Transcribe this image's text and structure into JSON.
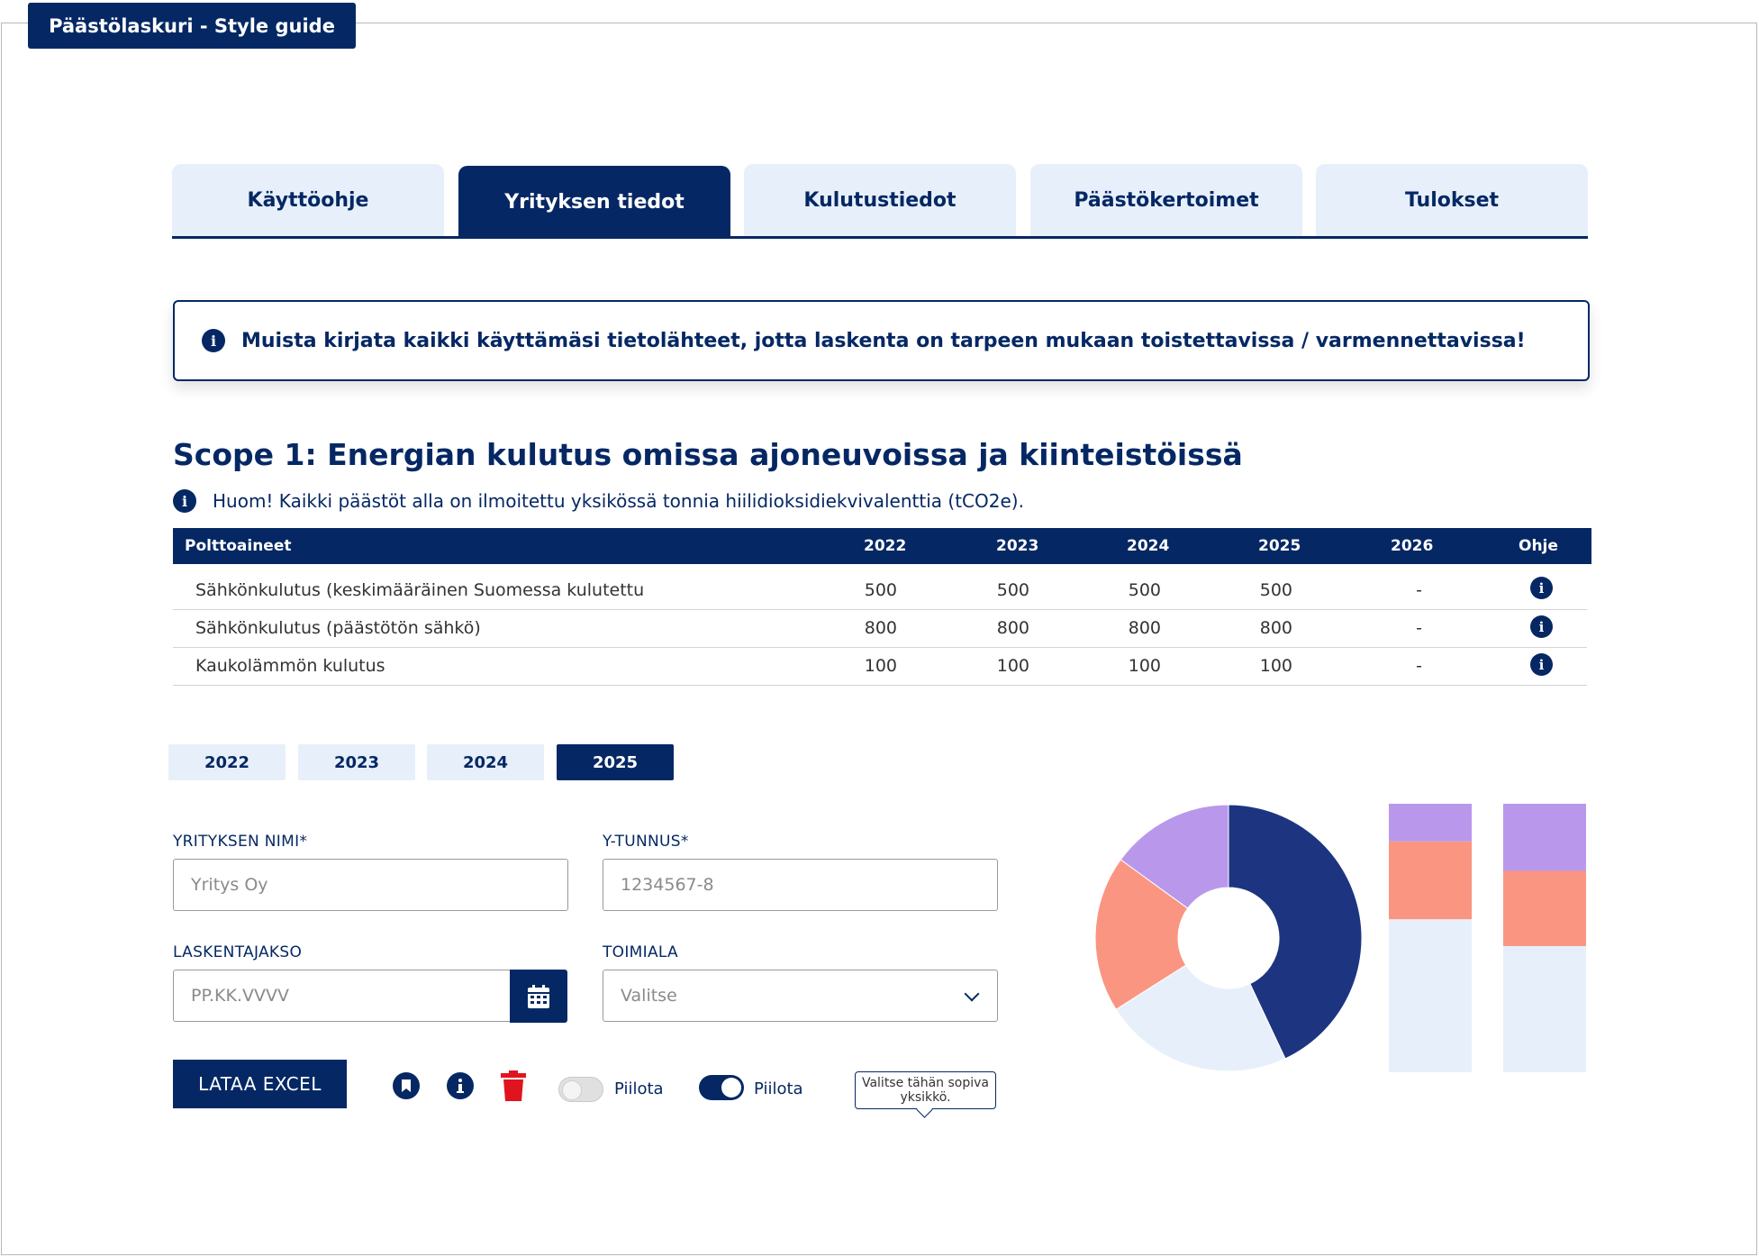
{
  "app": {
    "title": "Päästölaskuri - Style guide"
  },
  "tabs": [
    {
      "label": "Käyttöohje",
      "active": false
    },
    {
      "label": "Yrityksen tiedot",
      "active": true
    },
    {
      "label": "Kulutustiedot",
      "active": false
    },
    {
      "label": "Päästökertoimet",
      "active": false
    },
    {
      "label": "Tulokset",
      "active": false
    }
  ],
  "notice": {
    "icon": "info-icon",
    "text": "Muista kirjata kaikki käyttämäsi tietolähteet, jotta laskenta on tarpeen mukaan toistettavissa / varmennettavissa!"
  },
  "scope": {
    "title": "Scope 1: Energian kulutus omissa ajoneuvoissa ja kiinteistöissä",
    "note": "Huom! Kaikki päästöt alla on ilmoitettu yksikössä tonnia hiilidioksidiekvivalenttia (tCO2e)."
  },
  "table": {
    "headers": [
      "Polttoaineet",
      "2022",
      "2023",
      "2024",
      "2025",
      "2026",
      "Ohje"
    ],
    "rows": [
      {
        "name": "Sähkönkulutus (keskimääräinen Suomessa kulutettu",
        "values": [
          "500",
          "500",
          "500",
          "500",
          "-"
        ]
      },
      {
        "name": "Sähkönkulutus (päästötön sähkö)",
        "values": [
          "800",
          "800",
          "800",
          "800",
          "-"
        ]
      },
      {
        "name": "Kaukolämmön kulutus",
        "values": [
          "100",
          "100",
          "100",
          "100",
          "-"
        ]
      }
    ]
  },
  "years": [
    {
      "label": "2022",
      "active": false
    },
    {
      "label": "2023",
      "active": false
    },
    {
      "label": "2024",
      "active": false
    },
    {
      "label": "2025",
      "active": true
    }
  ],
  "form": {
    "company_name": {
      "label": "YRITYKSEN NIMI*",
      "placeholder": "Yritys Oy"
    },
    "business_id": {
      "label": "Y-TUNNUS*",
      "placeholder": "1234567-8"
    },
    "period": {
      "label": "LASKENTAJAKSO",
      "placeholder": "PP.KK.VVVV"
    },
    "industry": {
      "label": "TOIMIALA",
      "selected": "Valitse"
    }
  },
  "actions": {
    "excel_label": "LATAA EXCEL",
    "toggle_off_label": "Piilota",
    "toggle_on_label": "Piilota",
    "tooltip": "Valitse tähän sopiva yksikkö."
  },
  "colors": {
    "navy": "#052864",
    "light": "#e7f0fa",
    "purple": "#b998ec",
    "salmon": "#fa9582",
    "donut_dark": "#1d3580",
    "danger": "#e0141e"
  },
  "chart_data": [
    {
      "type": "pie",
      "variant": "donut",
      "slices": [
        {
          "value": 43,
          "color": "#1d3580"
        },
        {
          "value": 23,
          "color": "#e7f0fa"
        },
        {
          "value": 19,
          "color": "#fa9582"
        },
        {
          "value": 15,
          "color": "#b998ec"
        }
      ]
    },
    {
      "type": "bar",
      "stacked": true,
      "series": [
        {
          "color": "#e7f0fa",
          "values": [
            57,
            47
          ]
        },
        {
          "color": "#fa9582",
          "values": [
            29,
            28
          ]
        },
        {
          "color": "#b998ec",
          "values": [
            14,
            25
          ]
        }
      ]
    }
  ]
}
